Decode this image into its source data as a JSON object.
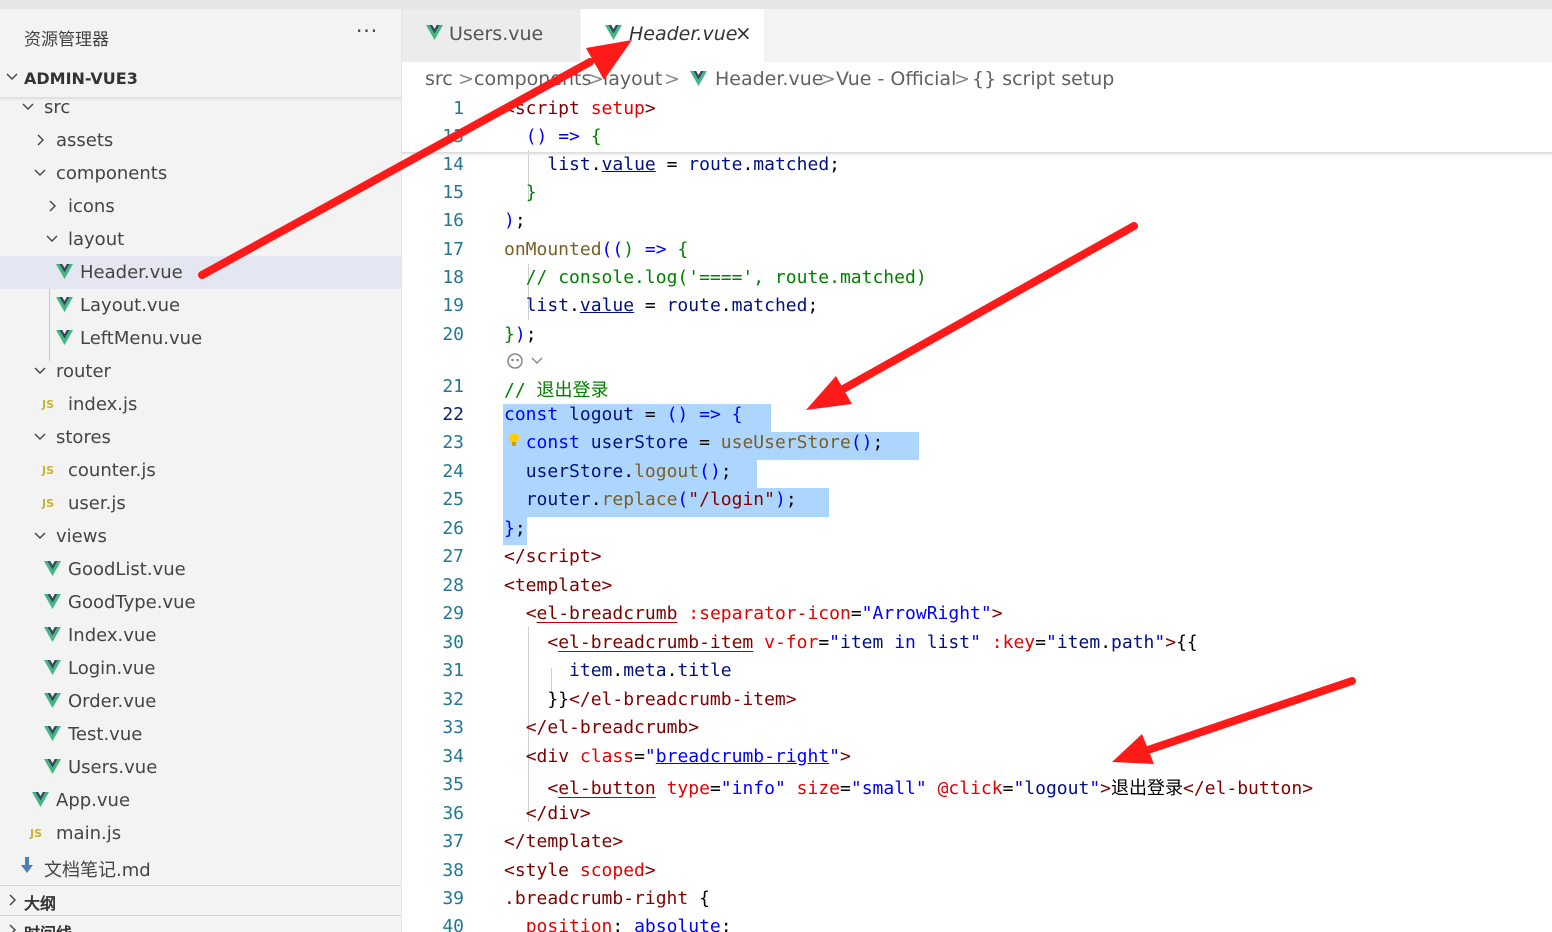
{
  "sidebar": {
    "title": "资源管理器",
    "more": "···",
    "root": "ADMIN-VUE3",
    "items": [
      {
        "label": "src",
        "kind": "folder"
      },
      {
        "label": "assets",
        "kind": "folder"
      },
      {
        "label": "components",
        "kind": "folder"
      },
      {
        "label": "icons",
        "kind": "folder"
      },
      {
        "label": "layout",
        "kind": "folder"
      },
      {
        "label": "Header.vue",
        "kind": "vue",
        "selected": true
      },
      {
        "label": "Layout.vue",
        "kind": "vue"
      },
      {
        "label": "LeftMenu.vue",
        "kind": "vue"
      },
      {
        "label": "router",
        "kind": "folder"
      },
      {
        "label": "index.js",
        "kind": "js"
      },
      {
        "label": "stores",
        "kind": "folder"
      },
      {
        "label": "counter.js",
        "kind": "js"
      },
      {
        "label": "user.js",
        "kind": "js"
      },
      {
        "label": "views",
        "kind": "folder"
      },
      {
        "label": "GoodList.vue",
        "kind": "vue"
      },
      {
        "label": "GoodType.vue",
        "kind": "vue"
      },
      {
        "label": "Index.vue",
        "kind": "vue"
      },
      {
        "label": "Login.vue",
        "kind": "vue"
      },
      {
        "label": "Order.vue",
        "kind": "vue"
      },
      {
        "label": "Test.vue",
        "kind": "vue"
      },
      {
        "label": "Users.vue",
        "kind": "vue"
      },
      {
        "label": "App.vue",
        "kind": "vue"
      },
      {
        "label": "main.js",
        "kind": "js"
      },
      {
        "label": "文档笔记.md",
        "kind": "md"
      }
    ],
    "js_badge": "JS",
    "sections": [
      {
        "label": "大纲"
      },
      {
        "label": "时间线"
      }
    ]
  },
  "tabs": [
    {
      "label": "Users.vue",
      "active": false
    },
    {
      "label": "Header.vue",
      "active": true,
      "close": "×"
    }
  ],
  "breadcrumb": [
    "src",
    "components",
    "layout",
    "Header.vue",
    "Vue - Official",
    "{} script setup"
  ],
  "breadcrumb_sep": ">",
  "editor": {
    "line_numbers": [
      "1",
      "13",
      "14",
      "15",
      "16",
      "17",
      "18",
      "19",
      "20",
      "21",
      "22",
      "23",
      "24",
      "25",
      "26",
      "27",
      "28",
      "29",
      "30",
      "31",
      "32",
      "33",
      "34",
      "35",
      "36",
      "37",
      "38",
      "39",
      "40"
    ],
    "current_line": "22"
  },
  "colors": {
    "arrow": "#ff1a1a",
    "selection": "#add6ff",
    "vue_green": "#41b883",
    "vue_dark": "#35495e"
  }
}
